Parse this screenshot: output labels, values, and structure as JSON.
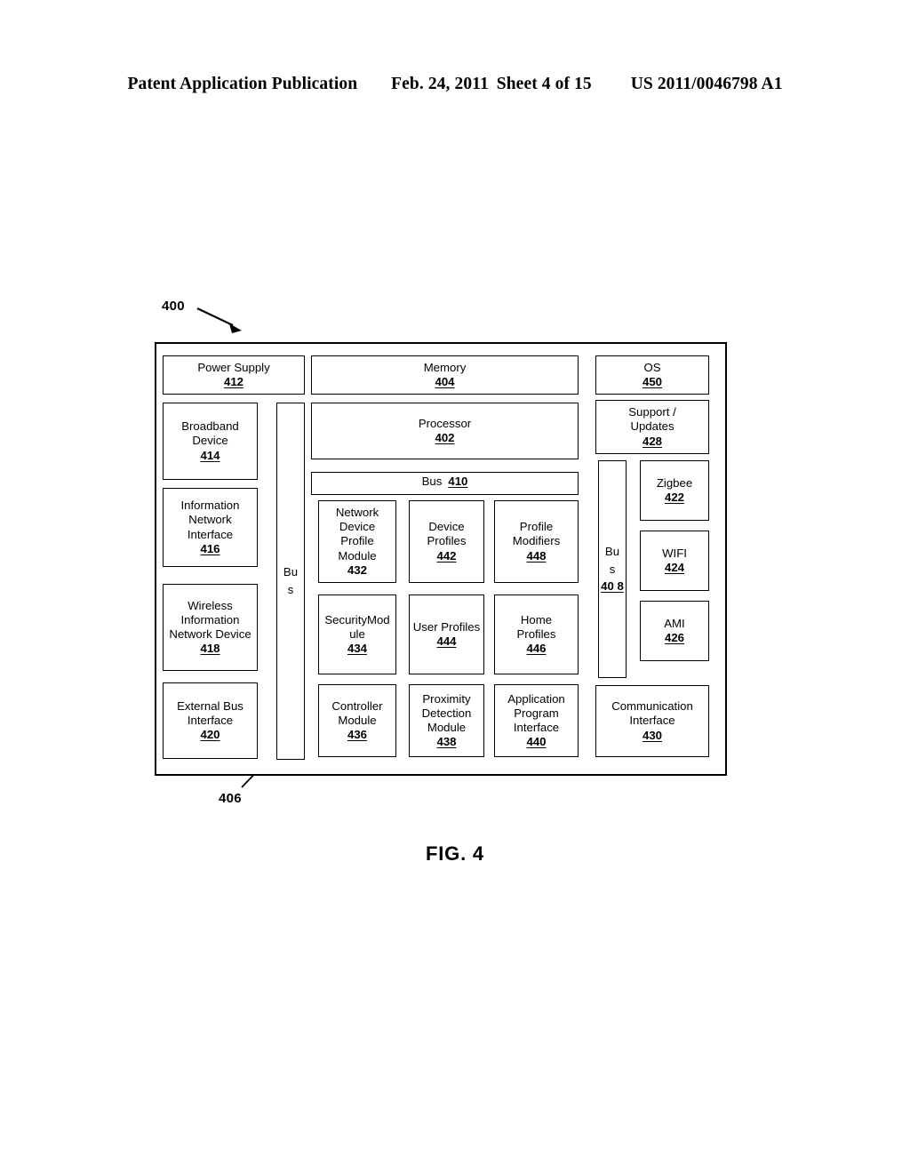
{
  "header": {
    "publication": "Patent Application Publication",
    "date": "Feb. 24, 2011",
    "sheet": "Sheet 4 of 15",
    "patent_number": "US 2011/0046798 A1"
  },
  "figure": {
    "caption": "FIG. 4",
    "system_ref": "400",
    "bus_ref": "406"
  },
  "blocks": {
    "power_supply": {
      "label": "Power Supply",
      "num": "412"
    },
    "memory": {
      "label": "Memory",
      "num": "404"
    },
    "os": {
      "label": "OS",
      "num": "450"
    },
    "broadband_device": {
      "label": "Broadband\nDevice",
      "num": "414"
    },
    "processor": {
      "label": "Processor",
      "num": "402"
    },
    "support_updates": {
      "label": "Support  /\nUpdates",
      "num": "428"
    },
    "info_net_interface": {
      "label": "Information\nNetwork\nInterface",
      "num": "416"
    },
    "bus_406": {
      "label": "Bu\ns",
      "num": ""
    },
    "bus_410": {
      "label": "Bus",
      "num": "410"
    },
    "bus_408": {
      "label": "Bu\ns",
      "num": "40\n8"
    },
    "zigbee": {
      "label": "Zigbee",
      "num": "422"
    },
    "net_device_profile": {
      "label": "Network\nDevice\nProfile\nModule",
      "num": "432"
    },
    "device_profiles": {
      "label": "Device\nProfiles",
      "num": "442"
    },
    "profile_modifiers": {
      "label": "Profile\nModifiers",
      "num": "448"
    },
    "wifi": {
      "label": "WIFI",
      "num": "424"
    },
    "wireless_info_net": {
      "label": "Wireless\nInformation\nNetwork Device",
      "num": "418"
    },
    "security_module": {
      "label": "SecurityMod\nule",
      "num": "434"
    },
    "user_profiles": {
      "label": "User Profiles",
      "num": "444"
    },
    "home_profiles": {
      "label": "Home\nProfiles",
      "num": "446"
    },
    "ami": {
      "label": "AMI",
      "num": "426"
    },
    "external_bus_iface": {
      "label": "External Bus\nInterface",
      "num": "420"
    },
    "controller_module": {
      "label": "Controller\nModule",
      "num": "436"
    },
    "proximity_detection": {
      "label": "Proximity\nDetection\nModule",
      "num": "438"
    },
    "api": {
      "label": "Application\nProgram\nInterface",
      "num": "440"
    },
    "comm_interface": {
      "label": "Communication\nInterface",
      "num": "430"
    }
  }
}
